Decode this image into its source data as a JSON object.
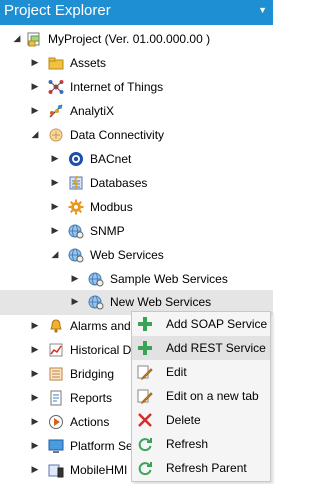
{
  "panel": {
    "title": "Project Explorer",
    "dropdown_glyph": "▼"
  },
  "tree": {
    "root": "MyProject (Ver. 01.00.000.00 )",
    "assets": "Assets",
    "iot": "Internet of Things",
    "analytix": "AnalytiX",
    "data_connectivity": "Data Connectivity",
    "bacnet": "BACnet",
    "databases": "Databases",
    "modbus": "Modbus",
    "snmp": "SNMP",
    "web_services": "Web Services",
    "sample_web_services": "Sample Web Services",
    "new_web_services": "New Web Services",
    "alarms": "Alarms and",
    "historical": "Historical D",
    "bridging": "Bridging",
    "reports": "Reports",
    "actions": "Actions",
    "platform": "Platform Se",
    "mobilehmi": "MobileHMI"
  },
  "context_menu": {
    "add_soap": "Add SOAP Service",
    "add_rest": "Add REST Service",
    "edit": "Edit",
    "edit_new_tab": "Edit on a new tab",
    "delete": "Delete",
    "refresh": "Refresh",
    "refresh_parent": "Refresh Parent"
  },
  "colors": {
    "title_bar": "#1e8fd3",
    "selection": "#e5e5e5",
    "menu_highlight": "#e2e2e2"
  }
}
